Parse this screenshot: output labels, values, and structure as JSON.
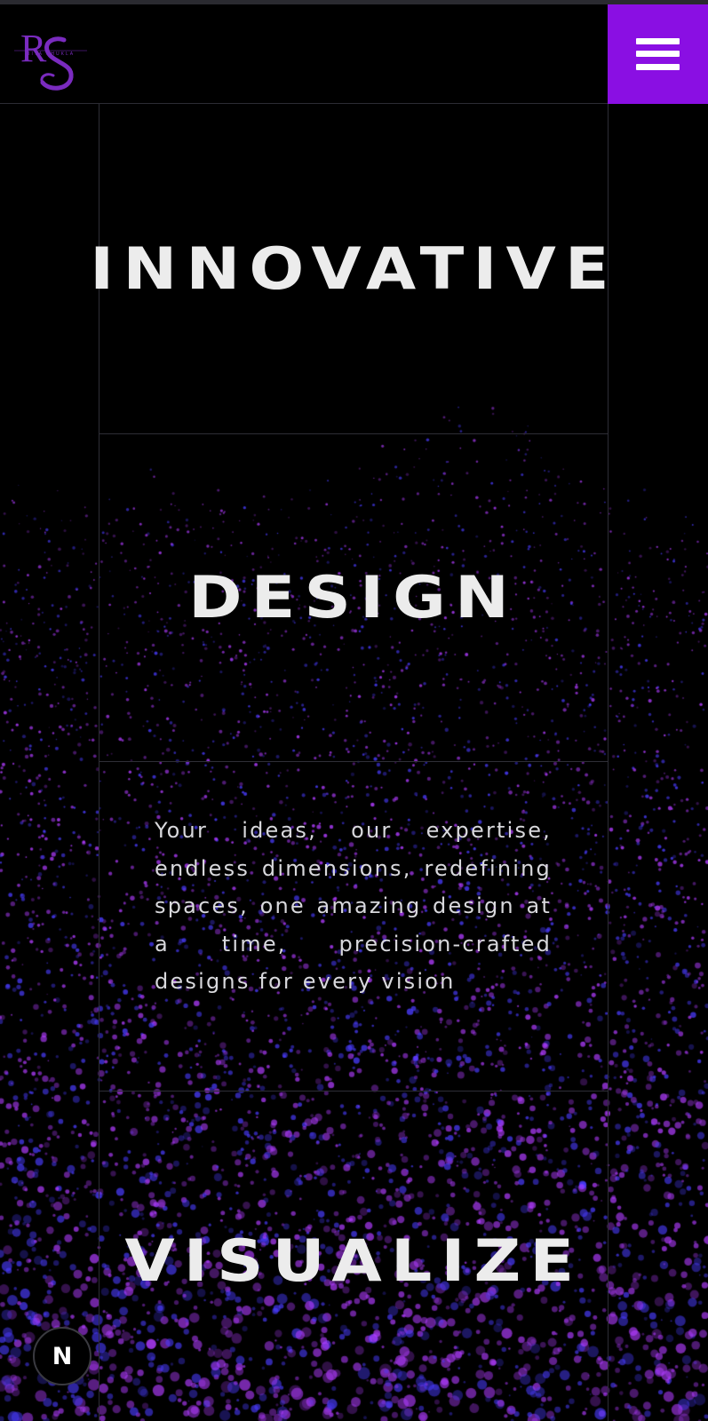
{
  "header": {
    "logo": {
      "monogram": "RS",
      "wordmark": "RITA SHUKLA",
      "color": "#7a2bbf"
    },
    "menu_button": {
      "icon": "hamburger-menu-icon",
      "background": "#8a0fe3"
    }
  },
  "hero": {
    "word_1": "INNOVATIVE",
    "word_2": "DESIGN",
    "tagline": "Your ideas, our expertise, endless dimensions, redefining spaces, one amazing design at a time, precision-crafted designs for every vision",
    "word_3": "VISUALIZE"
  },
  "badge": {
    "letter": "N",
    "icon": "nextjs-badge-icon"
  },
  "theme": {
    "background": "#000000",
    "text": "#ececec",
    "particle_purple": "#b03cff",
    "particle_blue": "#4a3cff",
    "grid_line": "#2e2e36"
  }
}
